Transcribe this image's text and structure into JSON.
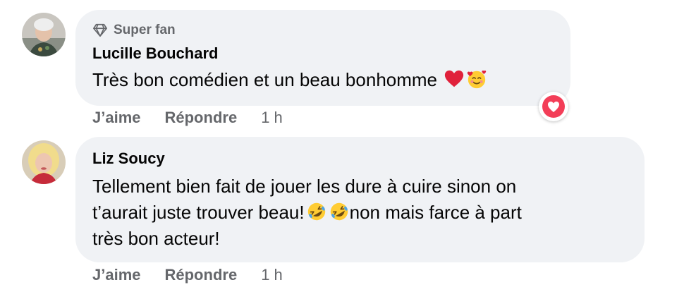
{
  "comments": [
    {
      "badge": "Super fan",
      "author": "Lucille Bouchard",
      "text": "Très bon comédien et un beau bonhomme",
      "like_label": "J’aime",
      "reply_label": "Répondre",
      "time": "1 h",
      "emojis": [
        "red-heart-icon",
        "smiling-face-with-hearts-icon"
      ],
      "reaction": "love-reaction-icon"
    },
    {
      "author": "Liz Soucy",
      "text_line1": "Tellement bien fait de jouer les dure à cuire sinon on",
      "text_line2a": "t’aurait juste trouver beau!",
      "text_line2b": "non mais farce à part",
      "text_line3": "très bon acteur!",
      "like_label": "J’aime",
      "reply_label": "Répondre",
      "time": "1 h",
      "emojis": [
        "rolling-on-floor-laughing-icon",
        "rolling-on-floor-laughing-icon"
      ]
    }
  ],
  "colors": {
    "bubble": "#f0f2f5",
    "secondary_text": "#65676b",
    "love": "#f33e58"
  }
}
